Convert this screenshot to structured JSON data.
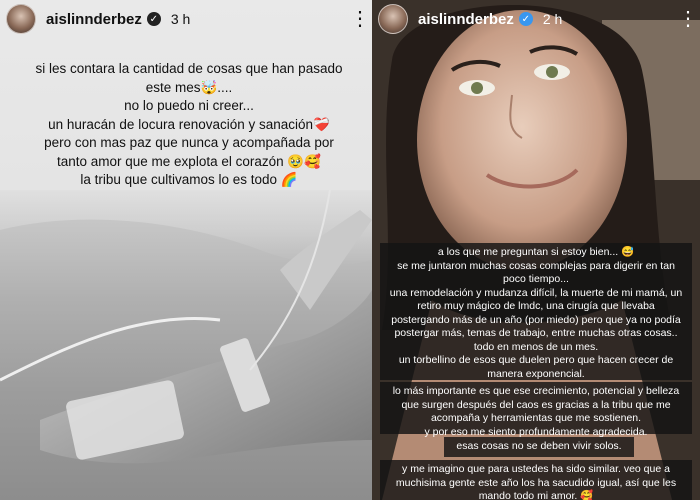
{
  "left_story": {
    "username": "aislinnderbez",
    "time": "3 h",
    "caption_lines": [
      "si les contara la cantidad de cosas que han pasado",
      "este mes🤯....",
      "no lo puedo ni creer...",
      "un huracán de locura renovación y sanación❤️‍🩹",
      "pero con mas paz que nunca y acompañada por",
      "tanto amor que me explota el corazón 🥹🥰",
      "la tribu que cultivamos lo es todo 🌈"
    ]
  },
  "right_story": {
    "username": "aislinnderbez",
    "time": "2 h",
    "box1_lines": [
      "a los que me preguntan si estoy bien... 😅",
      "se me juntaron muchas cosas complejas para digerir en tan",
      "poco tiempo...",
      "una remodelación y mudanza difícil, la muerte de mi mamá, un",
      "retiro muy mágico de lmdc, una cirugía que llevaba",
      "postergando más de un año (por miedo) pero que ya no podía",
      "postergar más, temas de trabajo, entre muchas otras cosas..",
      "todo en menos de un mes.",
      "un torbellino de esos que duelen pero que hacen crecer de",
      "manera exponencial."
    ],
    "box2_lines": [
      "lo más importante es que ese crecimiento, potencial y belleza",
      "que surgen después del caos es gracias a la tribu que me",
      "acompaña y herramientas que me sostienen.",
      "y por eso me siento profundamente agradecida."
    ],
    "box3_lines": [
      "esas cosas no se deben vivir solos."
    ],
    "box4_lines": [
      "y me imagino que para ustedes ha sido similar. veo que a",
      "muchisima gente este año los ha sacudido igual, así que les",
      "mando todo mi amor. 🥰"
    ]
  },
  "icons": {
    "verified": "verified-badge-icon",
    "more": "more-options-icon"
  }
}
